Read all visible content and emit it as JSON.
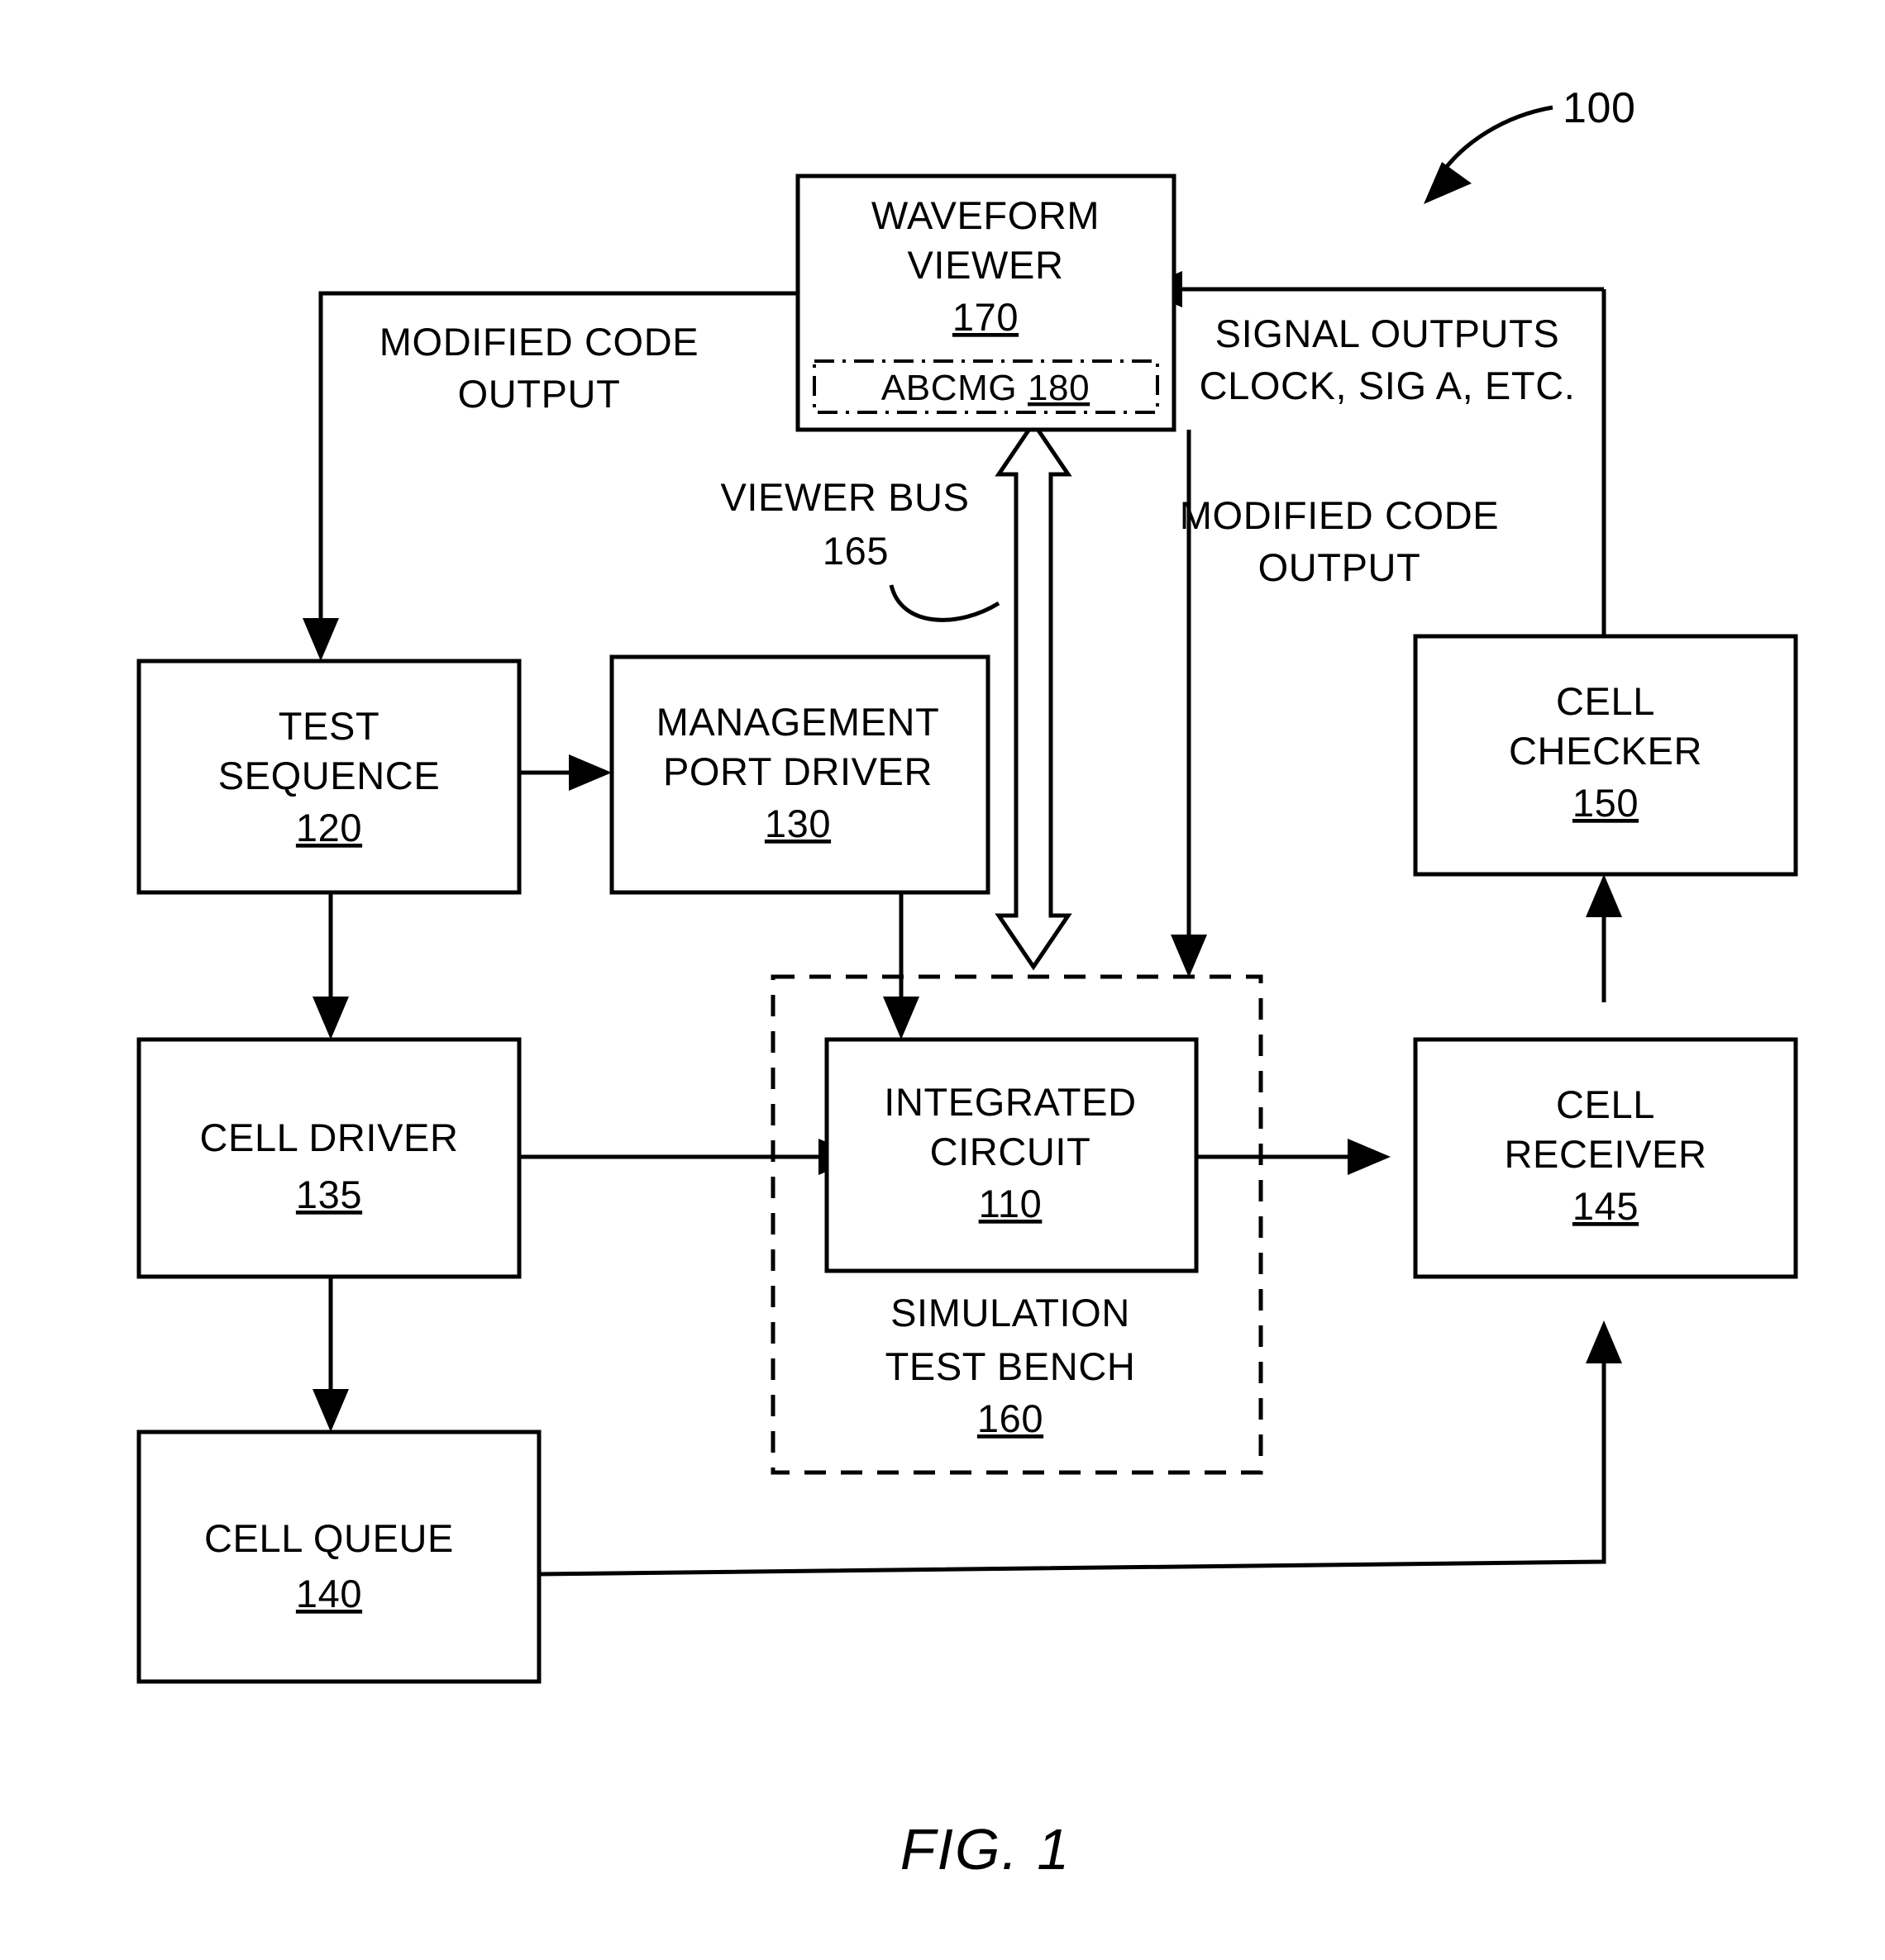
{
  "figure": {
    "caption": "FIG. 1",
    "reference_number": "100"
  },
  "boxes": {
    "waveform_viewer": {
      "line1": "WAVEFORM",
      "line2": "VIEWER",
      "num": "170"
    },
    "abcmg": {
      "label": "ABCMG",
      "num": "180"
    },
    "test_sequence": {
      "line1": "TEST",
      "line2": "SEQUENCE",
      "num": "120"
    },
    "management_port_driver": {
      "line1": "MANAGEMENT",
      "line2": "PORT DRIVER",
      "num": "130"
    },
    "cell_driver": {
      "line1": "CELL DRIVER",
      "num": "135"
    },
    "cell_queue": {
      "line1": "CELL QUEUE",
      "num": "140"
    },
    "integrated_circuit": {
      "line1": "INTEGRATED",
      "line2": "CIRCUIT",
      "num": "110"
    },
    "simulation_test_bench": {
      "line1": "SIMULATION",
      "line2": "TEST BENCH",
      "num": "160"
    },
    "cell_checker": {
      "line1": "CELL",
      "line2": "CHECKER",
      "num": "150"
    },
    "cell_receiver": {
      "line1": "CELL",
      "line2": "RECEIVER",
      "num": "145"
    }
  },
  "edge_labels": {
    "modified_code_output_left": {
      "line1": "MODIFIED CODE",
      "line2": "OUTPUT"
    },
    "signal_outputs": {
      "line1": "SIGNAL OUTPUTS",
      "line2": "CLOCK, SIG A, ETC."
    },
    "modified_code_output_right": {
      "line1": "MODIFIED CODE",
      "line2": "OUTPUT"
    },
    "viewer_bus": {
      "line1": "VIEWER BUS",
      "num": "165"
    }
  },
  "colors": {
    "ink": "#000000",
    "paper": "#ffffff"
  }
}
